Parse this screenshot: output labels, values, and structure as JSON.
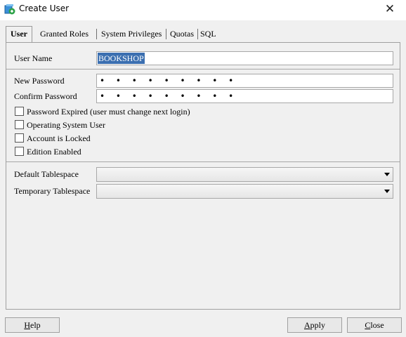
{
  "window": {
    "title": "Create User",
    "close_glyph": "✕"
  },
  "tabs": [
    {
      "label": "User",
      "active": true
    },
    {
      "label": "Granted Roles"
    },
    {
      "label": "System Privileges"
    },
    {
      "label": "Quotas"
    },
    {
      "label": "SQL"
    }
  ],
  "form": {
    "user_name_label": "User Name",
    "user_name_value": "BOOKSHOP",
    "new_password_label": "New Password",
    "new_password_value": "• • • • • • • • •",
    "confirm_password_label": "Confirm Password",
    "confirm_password_value": "• • • • • • • • •",
    "checkboxes": [
      {
        "label": "Password Expired (user must change next login)",
        "checked": false
      },
      {
        "label": "Operating System User",
        "checked": false
      },
      {
        "label": "Account is Locked",
        "checked": false
      },
      {
        "label": "Edition Enabled",
        "checked": false
      }
    ],
    "default_tablespace_label": "Default Tablespace",
    "default_tablespace_value": "",
    "temporary_tablespace_label": "Temporary Tablespace",
    "temporary_tablespace_value": ""
  },
  "buttons": {
    "help": {
      "prefix": "",
      "mnemonic": "H",
      "rest": "elp"
    },
    "apply": {
      "prefix": "",
      "mnemonic": "A",
      "rest": "pply"
    },
    "close": {
      "prefix": "",
      "mnemonic": "C",
      "rest": "lose"
    }
  },
  "colors": {
    "selection": "#3b6fb0",
    "dialog_bg": "#f0f0f0"
  }
}
